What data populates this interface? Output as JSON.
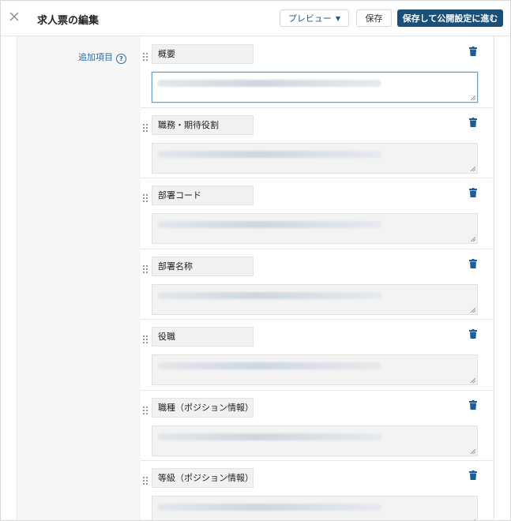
{
  "header": {
    "title": "求人票の編集",
    "preview_label": "プレビュー",
    "save_label": "保存",
    "publish_label": "保存して公開設定に進む"
  },
  "form": {
    "add_items_label": "追加項目",
    "help_glyph": "?",
    "items": [
      {
        "label": "概要",
        "focused": true
      },
      {
        "label": "職務・期待役割"
      },
      {
        "label": "部署コード"
      },
      {
        "label": "部署名称"
      },
      {
        "label": "役職"
      },
      {
        "label": "職種（ポジション情報）"
      },
      {
        "label": "等級（ポジション情報）"
      }
    ]
  },
  "colors": {
    "accent": "#1a4f78",
    "link": "#2b6ca3",
    "trash": "#1e5c9a"
  },
  "icons": [
    "close-icon",
    "chevron-down-icon",
    "help-icon",
    "drag-handle-icon",
    "trash-icon",
    "resize-grip-icon"
  ]
}
